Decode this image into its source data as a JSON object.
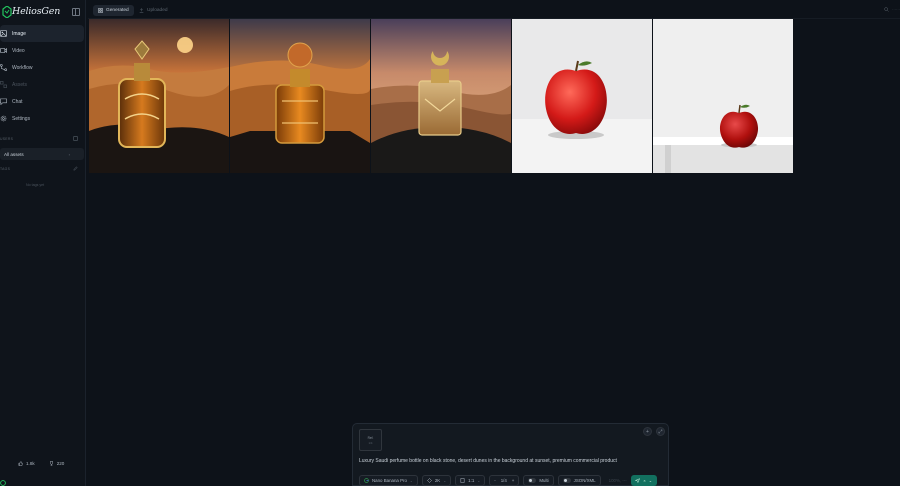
{
  "app": {
    "name": "HeliosGen",
    "accent": "#22c55e"
  },
  "sidebar": {
    "nav": [
      {
        "label": "Image",
        "icon": "image-icon",
        "active": true
      },
      {
        "label": "Video",
        "icon": "video-icon"
      },
      {
        "label": "Workflow",
        "icon": "workflow-icon"
      },
      {
        "label": "Assets",
        "icon": "assets-icon",
        "disabled": true
      },
      {
        "label": "Chat",
        "icon": "chat-icon"
      },
      {
        "label": "Settings",
        "icon": "gear-icon"
      }
    ],
    "section1_label": "USERS",
    "all_assets_label": "All assets",
    "section2_label": "TAGS",
    "empty_note": "No tags yet",
    "stats": {
      "likes": "1.8k",
      "trophies": "220"
    }
  },
  "topbar": {
    "tab_generated": "Generated",
    "tab_uploaded": "Uploaded",
    "search_placeholder": "······"
  },
  "gallery": [
    {
      "subject": "perfume-bottle-dunes-sunset-1"
    },
    {
      "subject": "perfume-bottle-dunes-sunset-2"
    },
    {
      "subject": "perfume-bottle-crescent-cap"
    },
    {
      "subject": "red-apple-white-background"
    },
    {
      "subject": "red-apple-white-table"
    }
  ],
  "prompt_panel": {
    "ref_label": "Ref.",
    "ref_sub": "1/4",
    "prompt": "Luxury Saudi perfume bottle on black stone, desert dunes in the background at sunset, premium commercial product",
    "model": "Nano Banana Pro",
    "resolution": "2K",
    "aspect": "1:1",
    "count": "1/4",
    "multi_label": "Multi",
    "json_label": "JSON/XML",
    "credits": "100%, ---"
  }
}
